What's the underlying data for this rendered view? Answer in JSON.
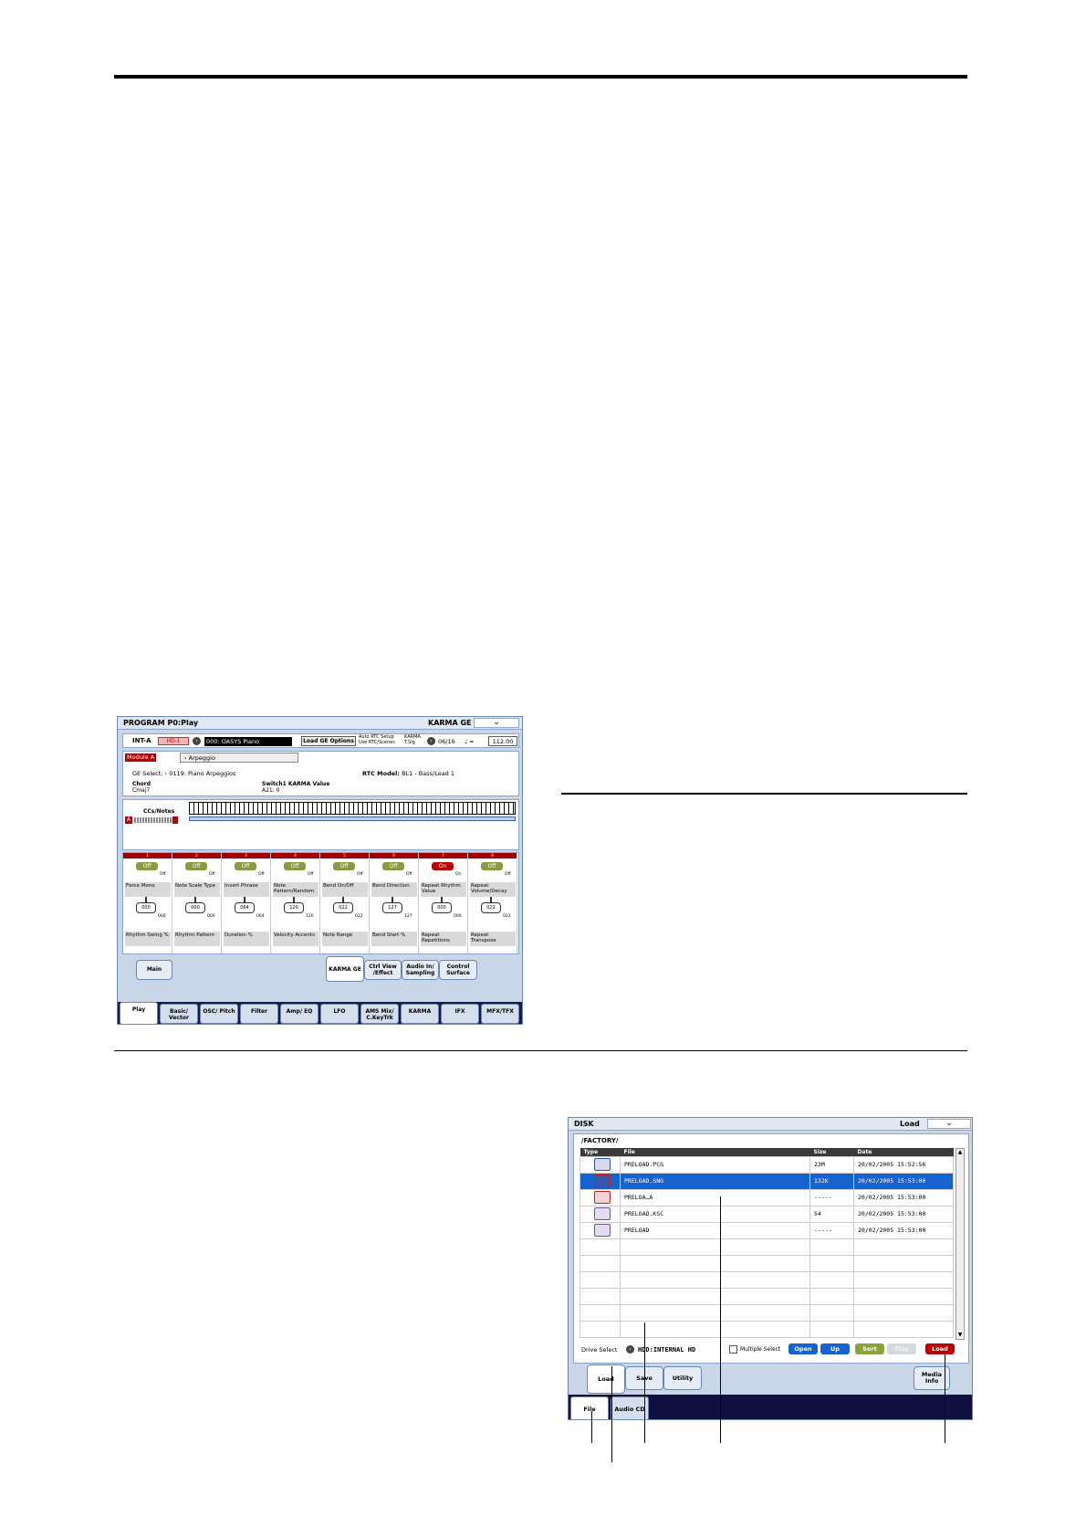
{
  "program_screen": {
    "title": "PROGRAM P0:Play",
    "page": "KARMA GE",
    "dropdown": "⌄",
    "bank": "INT-A",
    "hd": "HD-1",
    "program_name": "000: OASYS Piano",
    "load_ge_options": "Load GE Options",
    "auto_rtc_1": "Auto RTC Setup",
    "auto_rtc_2": "Use RTC/Scenes",
    "karma_tsig_1": "KARMA",
    "karma_tsig_2": "T.Sig",
    "tsig_value": "06/16",
    "tempo_label": "♩ =",
    "tempo_value": "112.00",
    "module": "Module A",
    "arpeggio_tab": "Arpeggio",
    "ge_select_label": "GE Select:",
    "ge_select_value": "0119: Piano Arpeggios",
    "rtc_model_label": "RTC Model:",
    "rtc_model_value": "BL1 - Bass/Lead 1",
    "chord_label": "Chord",
    "chord_value": "Cmaj7",
    "switch_label": "Switch1  KARMA Value",
    "switch_value": "A21: 0",
    "ccs_notes": "CCs/Notes",
    "a_label": "A",
    "cells": [
      {
        "num": "1",
        "switch": "Off",
        "state": "Off",
        "label1": "Force Mono",
        "knob": "000",
        "kval": "000",
        "label2": "Rhythm Swing %"
      },
      {
        "num": "2",
        "switch": "Off",
        "state": "Off",
        "label1": "Note Scale Type",
        "knob": "000",
        "kval": "000",
        "label2": "Rhythm Pattern"
      },
      {
        "num": "3",
        "switch": "Off",
        "state": "Off",
        "label1": "Invert Phrase",
        "knob": "064",
        "kval": "064",
        "label2": "Duration %"
      },
      {
        "num": "4",
        "switch": "Off",
        "state": "Off",
        "label1": "Note Pattern/Random",
        "knob": "120",
        "kval": "120",
        "label2": "Velocity Accents"
      },
      {
        "num": "5",
        "switch": "Off",
        "state": "Off",
        "label1": "Bend On/Off",
        "knob": "022",
        "kval": "022",
        "label2": "Note Range"
      },
      {
        "num": "6",
        "switch": "Off",
        "state": "Off",
        "label1": "Bend Direction",
        "knob": "127",
        "kval": "127",
        "label2": "Bend Start %"
      },
      {
        "num": "7",
        "switch": "On",
        "state": "On",
        "label1": "Repeat Rhythm Value",
        "knob": "000",
        "kval": "000",
        "label2": "Repeat Repetitions"
      },
      {
        "num": "8",
        "switch": "Off",
        "state": "Off",
        "label1": "Repeat Volume/Decay",
        "knob": "022",
        "kval": "022",
        "label2": "Repeat Transpose"
      }
    ],
    "subtabs": [
      "Main",
      "KARMA GE",
      "Ctrl View /Effect",
      "Audio In/ Sampling",
      "Control Surface"
    ],
    "main_tabs": [
      "Play",
      "Basic/ Vector",
      "OSC/ Pitch",
      "Filter",
      "Amp/ EQ",
      "LFO",
      "AMS Mix/ C.KeyTrk",
      "KARMA",
      "IFX",
      "MFX/TFX"
    ]
  },
  "disk_screen": {
    "title": "DISK",
    "page": "Load",
    "dropdown": "⌄",
    "path": "/FACTORY/",
    "columns": [
      "Type",
      "File",
      "Size",
      "Date"
    ],
    "files": [
      {
        "icon": "pcg-icon",
        "color": "#3050b0",
        "name": "PRELOAD.PCG",
        "size": "23M",
        "date": "20/02/2005  15:52:56"
      },
      {
        "icon": "song-icon",
        "color": "#c02020",
        "name": "PRELOAD.SNG",
        "size": "132K",
        "date": "20/02/2005  15:53:00"
      },
      {
        "icon": "folder-icon",
        "color": "#c02020",
        "name": "PRELOA…A",
        "size": "-----",
        "date": "20/02/2005  15:53:00"
      },
      {
        "icon": "ksc-icon",
        "color": "#7050a0",
        "name": "PRELOAD.KSC",
        "size": "54",
        "date": "20/02/2005  15:53:00"
      },
      {
        "icon": "folder-icon",
        "color": "#7050a0",
        "name": "PRELOAD",
        "size": "-----",
        "date": "20/02/2005  15:53:00"
      }
    ],
    "drive_select_label": "Drive Select",
    "drive_name": "HDD:INTERNAL HD",
    "multiple_select": "Multiple Select",
    "buttons": {
      "open": "Open",
      "up": "Up",
      "sort": "Sort",
      "play": "Play",
      "load": "Load"
    },
    "subtabs": [
      "Load",
      "Save",
      "Utility",
      "Media Info"
    ],
    "main_tabs": [
      "File",
      "Audio CD"
    ]
  }
}
